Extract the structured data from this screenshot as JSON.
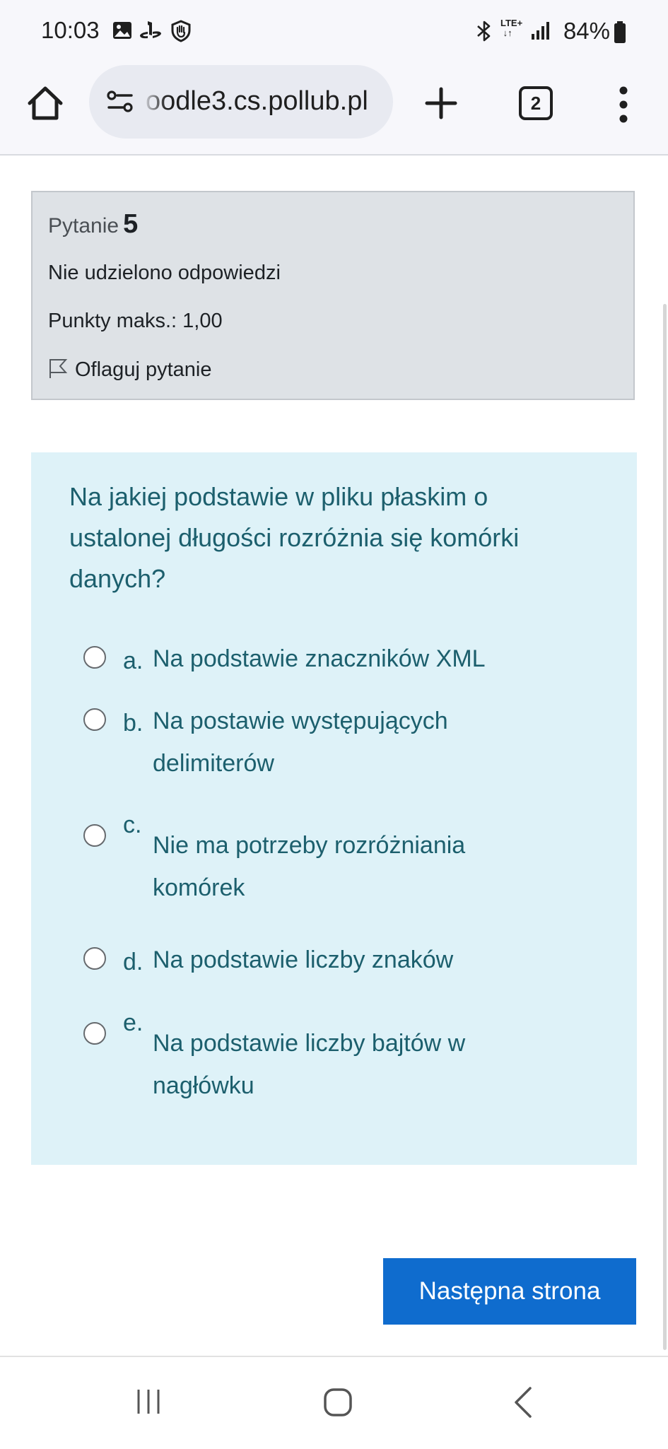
{
  "status_bar": {
    "time": "10:03",
    "network": "LTE+",
    "battery": "84%",
    "icons": [
      "gallery-icon",
      "playstation-icon",
      "shield-hand-icon",
      "bluetooth-icon",
      "lte-icon",
      "signal-icon",
      "battery-icon"
    ]
  },
  "browser": {
    "url": "oodle3.cs.pollub.pl",
    "tab_count": "2"
  },
  "question_info": {
    "label": "Pytanie",
    "number": "5",
    "status": "Nie udzielono odpowiedzi",
    "points": "Punkty maks.: 1,00",
    "flag_label": "Oflaguj pytanie"
  },
  "question": {
    "text": "Na jakiej podstawie w pliku płaskim o ustalonej długości rozróżnia się komórki danych?",
    "options": [
      {
        "letter": "a.",
        "text": "Na podstawie znaczników XML"
      },
      {
        "letter": "b.",
        "text": "Na postawie występujących delimiterów"
      },
      {
        "letter": "c.",
        "text": "Nie ma potrzeby rozróżniania komórek"
      },
      {
        "letter": "d.",
        "text": "Na podstawie liczby znaków"
      },
      {
        "letter": "e.",
        "text": "Na podstawie liczby bajtów w nagłówku"
      }
    ]
  },
  "next_button": "Następna strona",
  "colors": {
    "accent": "#0f6cce",
    "question_bg": "#def2f8",
    "question_text": "#1c5f6d",
    "info_bg": "#dee2e6"
  }
}
